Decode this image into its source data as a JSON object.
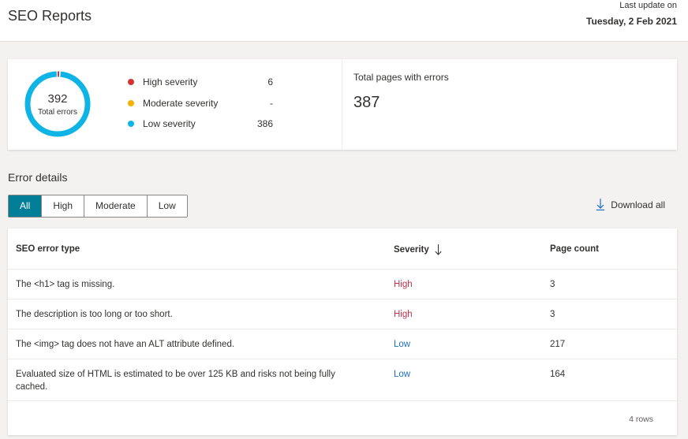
{
  "header": {
    "title": "SEO Reports",
    "last_update_label": "Last update on",
    "last_update_date": "Tuesday, 2 Feb 2021"
  },
  "summary": {
    "total_errors_value": "392",
    "total_errors_label": "Total errors",
    "severities": [
      {
        "name": "High severity",
        "count": "6",
        "color": "#d13438",
        "value": 6
      },
      {
        "name": "Moderate severity",
        "count": "-",
        "color": "#f2b300",
        "value": 0
      },
      {
        "name": "Low severity",
        "count": "386",
        "color": "#0fb4e6",
        "value": 386
      }
    ],
    "total_pages_label": "Total pages with errors",
    "total_pages_value": "387"
  },
  "details": {
    "title": "Error details",
    "filters": [
      {
        "label": "All",
        "active": true
      },
      {
        "label": "High",
        "active": false
      },
      {
        "label": "Moderate",
        "active": false
      },
      {
        "label": "Low",
        "active": false
      }
    ],
    "download_label": "Download all"
  },
  "table": {
    "columns": {
      "type": "SEO error type",
      "severity": "Severity",
      "count": "Page count"
    },
    "rows": [
      {
        "type": "The <h1> tag is missing.",
        "severity": "High",
        "count": "3"
      },
      {
        "type": "The description is too long or too short.",
        "severity": "High",
        "count": "3"
      },
      {
        "type": "The <img> tag does not have an ALT attribute defined.",
        "severity": "Low",
        "count": "217"
      },
      {
        "type": "Evaluated size of HTML is estimated to be over 125 KB and risks not being fully cached.",
        "severity": "Low",
        "count": "164"
      }
    ],
    "rows_count": "4 rows"
  },
  "colors": {
    "accent": "#037e99",
    "high": "#c4314b",
    "low": "#1b6ec2"
  }
}
